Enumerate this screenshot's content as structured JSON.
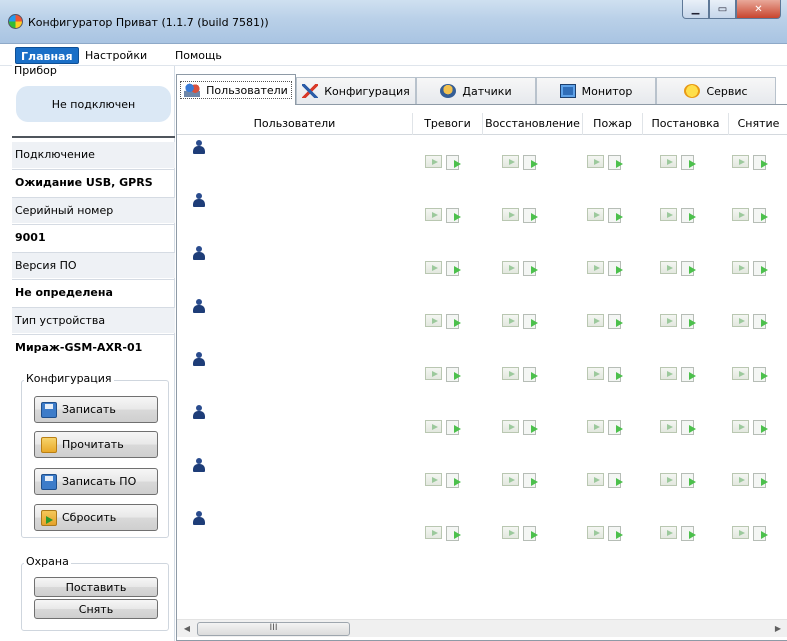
{
  "window": {
    "title": "Конфигуратор Приват (1.1.7 (build 7581))"
  },
  "menu": {
    "items": [
      "Главная",
      "Настройки",
      "Помощь"
    ]
  },
  "device": {
    "group_title": "Прибор",
    "status": "Не подключен",
    "connection_label": "Подключение",
    "connection_value": "Ожидание USB, GPRS",
    "serial_label": "Серийный номер",
    "serial_value": "9001",
    "firmware_label": "Версия ПО",
    "firmware_value": "Не определена",
    "type_label": "Тип устройства",
    "type_value": "Мираж-GSM-AXR-01"
  },
  "config": {
    "group_title": "Конфигурация",
    "write": "Записать",
    "read": "Прочитать",
    "write_fw": "Записать ПО",
    "reset": "Сбросить"
  },
  "guard": {
    "group_title": "Охрана",
    "arm": "Поставить",
    "disarm": "Снять"
  },
  "tabs": [
    {
      "label": "Пользователи",
      "icon": "users-icon"
    },
    {
      "label": "Конфигурация",
      "icon": "config-icon"
    },
    {
      "label": "Датчики",
      "icon": "sensor-icon"
    },
    {
      "label": "Монитор",
      "icon": "monitor-icon"
    },
    {
      "label": "Сервис",
      "icon": "service-icon"
    }
  ],
  "grid": {
    "columns": [
      "Пользователи",
      "Тревоги",
      "Восстановление",
      "Пожар",
      "Постановка",
      "Снятие"
    ],
    "row_count": 8
  },
  "scrollbar": {
    "thumb_grip": "III"
  }
}
